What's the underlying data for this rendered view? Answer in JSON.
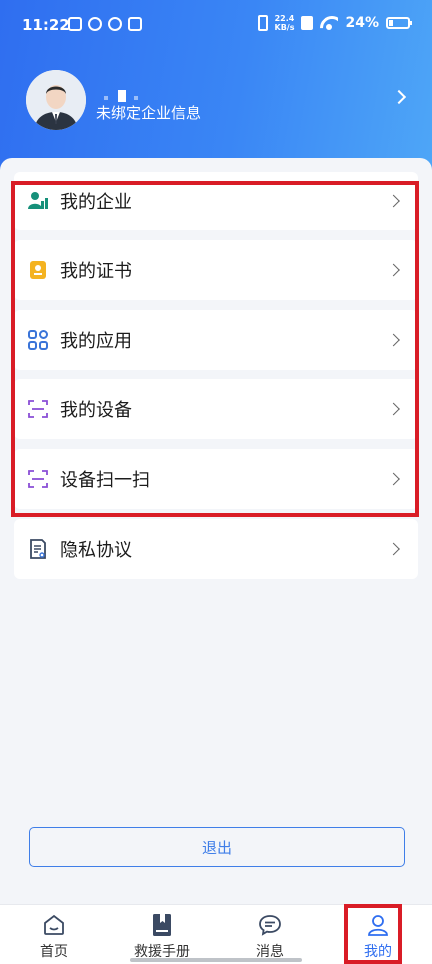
{
  "status_bar": {
    "time": "11:22",
    "net_speed_value": "22.4",
    "net_speed_unit": "KB/s",
    "battery_percent": "24%",
    "battery_level": 0.24
  },
  "profile": {
    "company_status": "未绑定企业信息"
  },
  "menu": {
    "items": [
      {
        "label": "我的企业",
        "icon": "company-user-icon"
      },
      {
        "label": "我的证书",
        "icon": "certificate-icon"
      },
      {
        "label": "我的应用",
        "icon": "apps-grid-icon"
      },
      {
        "label": "我的设备",
        "icon": "scan-frame-icon"
      },
      {
        "label": "设备扫一扫",
        "icon": "scan-frame-icon"
      },
      {
        "label": "隐私协议",
        "icon": "document-icon"
      }
    ]
  },
  "logout": {
    "label": "退出"
  },
  "tabbar": {
    "items": [
      {
        "label": "首页",
        "icon": "home-icon"
      },
      {
        "label": "救援手册",
        "icon": "book-icon"
      },
      {
        "label": "消息",
        "icon": "message-icon"
      },
      {
        "label": "我的",
        "icon": "profile-icon",
        "active": true
      }
    ]
  },
  "colors": {
    "header_start": "#2f6ef0",
    "header_end": "#4ea6f7",
    "accent": "#2f6ef0",
    "highlight": "#d91c26"
  }
}
